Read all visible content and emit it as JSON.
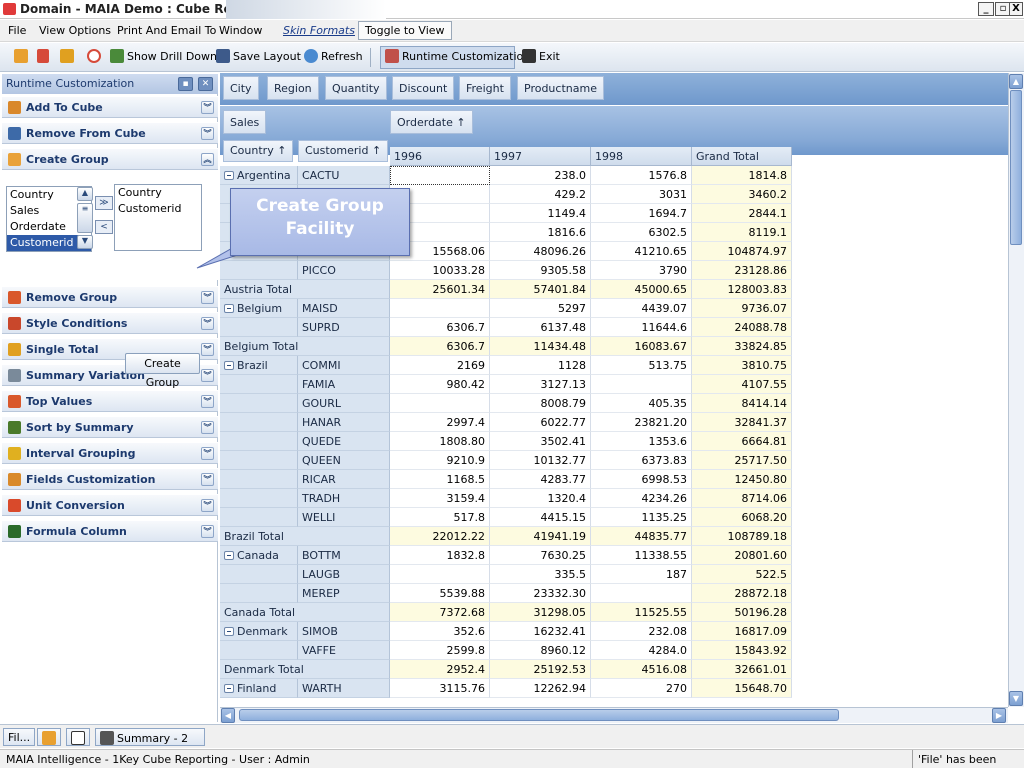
{
  "window": {
    "title": "Domain - MAIA Demo : Cube Report",
    "controls": [
      "_",
      "▫",
      "X"
    ]
  },
  "menu": {
    "file": "File",
    "view": "View Options",
    "print": "Print And Email To",
    "window": "Window",
    "skin": "Skin Formats",
    "toggle": "Toggle to View"
  },
  "toolbar": {
    "drill": "Show Drill Down",
    "save": "Save Layout",
    "refresh": "Refresh",
    "runtime": "Runtime Customization",
    "exit": "Exit"
  },
  "panel": {
    "title": "Runtime Customization",
    "items": [
      {
        "label": "Add To Cube",
        "icon": "add-cube-icon",
        "color": "#d9882b"
      },
      {
        "label": "Remove From Cube",
        "icon": "remove-cube-icon",
        "color": "#3d6aa8"
      },
      {
        "label": "Create Group",
        "icon": "create-group-icon",
        "color": "#e9a23a"
      },
      {
        "label": "Remove Group",
        "icon": "remove-group-icon",
        "color": "#d9582b"
      },
      {
        "label": "Style Conditions",
        "icon": "style-conditions-icon",
        "color": "#c9472b"
      },
      {
        "label": "Single Total",
        "icon": "single-total-icon",
        "color": "#e0a020"
      },
      {
        "label": "Summary Variation",
        "icon": "summary-variation-icon",
        "color": "#7a8a9a"
      },
      {
        "label": "Top Values",
        "icon": "top-values-icon",
        "color": "#d9582b"
      },
      {
        "label": "Sort by Summary",
        "icon": "sort-summary-icon",
        "color": "#4a7a2a"
      },
      {
        "label": "Interval Grouping",
        "icon": "interval-grouping-icon",
        "color": "#e0b020"
      },
      {
        "label": "Fields Customization",
        "icon": "fields-customization-icon",
        "color": "#d98a2b"
      },
      {
        "label": "Unit Conversion",
        "icon": "unit-conversion-icon",
        "color": "#d94a2b"
      },
      {
        "label": "Formula Column",
        "icon": "formula-column-icon",
        "color": "#2a6a2a"
      }
    ],
    "create_group": {
      "available": [
        "Country",
        "Sales",
        "Orderdate",
        "Customerid"
      ],
      "selected_index": 3,
      "grouped": [
        "Country",
        "Customerid"
      ],
      "button": "Create Group"
    }
  },
  "callout": "Create Group Facility",
  "grid": {
    "filter_fields": [
      "City",
      "Region",
      "Quantity",
      "Discount",
      "Freight",
      "Productname"
    ],
    "data_field": "Sales",
    "column_field": "Orderdate",
    "row_fields": [
      "Country",
      "Customerid"
    ],
    "columns": [
      "1996",
      "1997",
      "1998",
      "Grand Total"
    ],
    "rows": [
      {
        "country": "Argentina",
        "customer": "CACTU",
        "v": [
          "",
          "238.0",
          "1576.8",
          "1814.8"
        ]
      },
      {
        "country": "",
        "customer": "",
        "v": [
          "",
          "429.2",
          "3031",
          "3460.2"
        ]
      },
      {
        "country": "",
        "customer": "",
        "v": [
          "",
          "1149.4",
          "1694.7",
          "2844.1"
        ]
      },
      {
        "country": "",
        "customer": "",
        "v": [
          "",
          "1816.6",
          "6302.5",
          "8119.1"
        ]
      },
      {
        "country": "",
        "customer": "",
        "v": [
          "15568.06",
          "48096.26",
          "41210.65",
          "104874.97"
        ]
      },
      {
        "country": "",
        "customer": "PICCO",
        "v": [
          "10033.28",
          "9305.58",
          "3790",
          "23128.86"
        ]
      },
      {
        "total": "Austria Total",
        "v": [
          "25601.34",
          "57401.84",
          "45000.65",
          "128003.83"
        ]
      },
      {
        "country": "Belgium",
        "customer": "MAISD",
        "v": [
          "",
          "5297",
          "4439.07",
          "9736.07"
        ]
      },
      {
        "country": "",
        "customer": "SUPRD",
        "v": [
          "6306.7",
          "6137.48",
          "11644.6",
          "24088.78"
        ]
      },
      {
        "total": "Belgium Total",
        "v": [
          "6306.7",
          "11434.48",
          "16083.67",
          "33824.85"
        ]
      },
      {
        "country": "Brazil",
        "customer": "COMMI",
        "v": [
          "2169",
          "1128",
          "513.75",
          "3810.75"
        ]
      },
      {
        "country": "",
        "customer": "FAMIA",
        "v": [
          "980.42",
          "3127.13",
          "",
          "4107.55"
        ]
      },
      {
        "country": "",
        "customer": "GOURL",
        "v": [
          "",
          "8008.79",
          "405.35",
          "8414.14"
        ]
      },
      {
        "country": "",
        "customer": "HANAR",
        "v": [
          "2997.4",
          "6022.77",
          "23821.20",
          "32841.37"
        ]
      },
      {
        "country": "",
        "customer": "QUEDE",
        "v": [
          "1808.80",
          "3502.41",
          "1353.6",
          "6664.81"
        ]
      },
      {
        "country": "",
        "customer": "QUEEN",
        "v": [
          "9210.9",
          "10132.77",
          "6373.83",
          "25717.50"
        ]
      },
      {
        "country": "",
        "customer": "RICAR",
        "v": [
          "1168.5",
          "4283.77",
          "6998.53",
          "12450.80"
        ]
      },
      {
        "country": "",
        "customer": "TRADH",
        "v": [
          "3159.4",
          "1320.4",
          "4234.26",
          "8714.06"
        ]
      },
      {
        "country": "",
        "customer": "WELLI",
        "v": [
          "517.8",
          "4415.15",
          "1135.25",
          "6068.20"
        ]
      },
      {
        "total": "Brazil Total",
        "v": [
          "22012.22",
          "41941.19",
          "44835.77",
          "108789.18"
        ]
      },
      {
        "country": "Canada",
        "customer": "BOTTM",
        "v": [
          "1832.8",
          "7630.25",
          "11338.55",
          "20801.60"
        ]
      },
      {
        "country": "",
        "customer": "LAUGB",
        "v": [
          "",
          "335.5",
          "187",
          "522.5"
        ]
      },
      {
        "country": "",
        "customer": "MEREP",
        "v": [
          "5539.88",
          "23332.30",
          "",
          "28872.18"
        ]
      },
      {
        "total": "Canada Total",
        "v": [
          "7372.68",
          "31298.05",
          "11525.55",
          "50196.28"
        ]
      },
      {
        "country": "Denmark",
        "customer": "SIMOB",
        "v": [
          "352.6",
          "16232.41",
          "232.08",
          "16817.09"
        ]
      },
      {
        "country": "",
        "customer": "VAFFE",
        "v": [
          "2599.8",
          "8960.12",
          "4284.0",
          "15843.92"
        ]
      },
      {
        "total": "Denmark Total",
        "v": [
          "2952.4",
          "25192.53",
          "4516.08",
          "32661.01"
        ]
      },
      {
        "country": "Finland",
        "customer": "WARTH",
        "v": [
          "3115.76",
          "12262.94",
          "270",
          "15648.70"
        ]
      }
    ]
  },
  "tabs": [
    {
      "label": "Fil..."
    },
    {
      "label": ""
    },
    {
      "label": ""
    },
    {
      "label": "Summary - 2"
    }
  ],
  "status": {
    "left": "MAIA Intelligence - 1Key Cube Reporting - User : Admin",
    "right": "'File' has been clicked"
  }
}
